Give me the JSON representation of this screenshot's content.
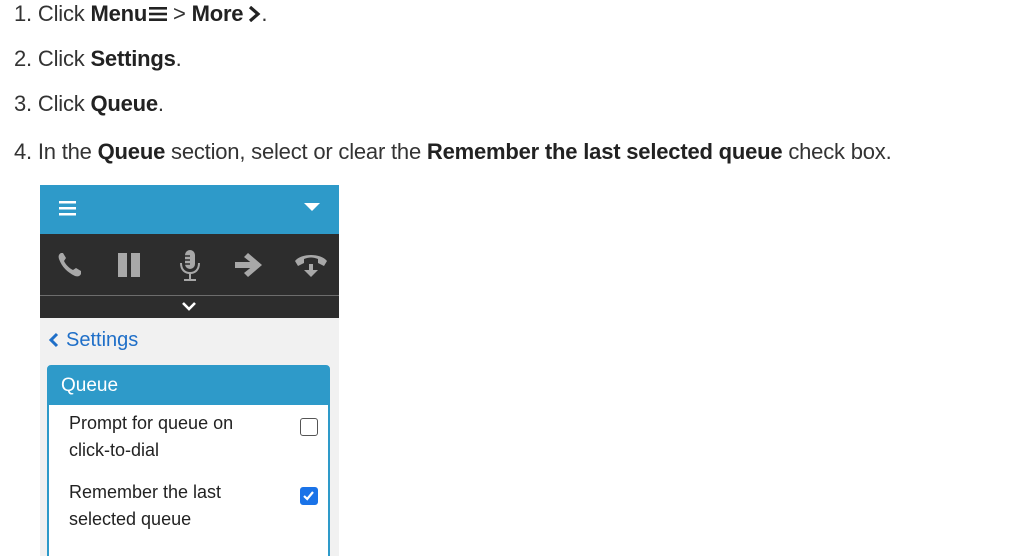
{
  "steps": [
    {
      "number": "1.",
      "pre": "Click ",
      "bold1": "Menu",
      "mid": " > ",
      "bold2": "More",
      "post": "."
    },
    {
      "number": "2.",
      "pre": "Click ",
      "bold1": "Settings",
      "post": "."
    },
    {
      "number": "3.",
      "pre": "Click ",
      "bold1": "Queue",
      "post": "."
    },
    {
      "number": "4.",
      "pre": "In the ",
      "bold1": "Queue",
      "mid": " section, select or clear the ",
      "bold2": "Remember the last selected queue",
      "post": " check box."
    }
  ],
  "step_icons": [
    "menu-icon",
    "chevron-right-icon"
  ],
  "widget": {
    "topbar": {
      "color": "#2e9ac9",
      "icons": [
        "menu-icon",
        "caret-down-icon"
      ]
    },
    "callbar": {
      "color": "#2d2d2d",
      "icon_color": "#a8a8a8",
      "icons": [
        "phone-icon",
        "pause-icon",
        "microphone-icon",
        "transfer-arrow-icon",
        "hangup-icon"
      ],
      "expand_icon": "chevron-down-icon"
    },
    "back_label": "Settings",
    "back_icon": "chevron-left-icon",
    "panel": {
      "title": "Queue",
      "options": [
        {
          "line1": "Prompt for queue on",
          "line2": "click-to-dial",
          "checked": false
        },
        {
          "line1": "Remember the last",
          "line2": "selected queue",
          "checked": true
        }
      ]
    },
    "link_color": "#1f6fc8",
    "checkbox_color": "#1a73e8"
  }
}
